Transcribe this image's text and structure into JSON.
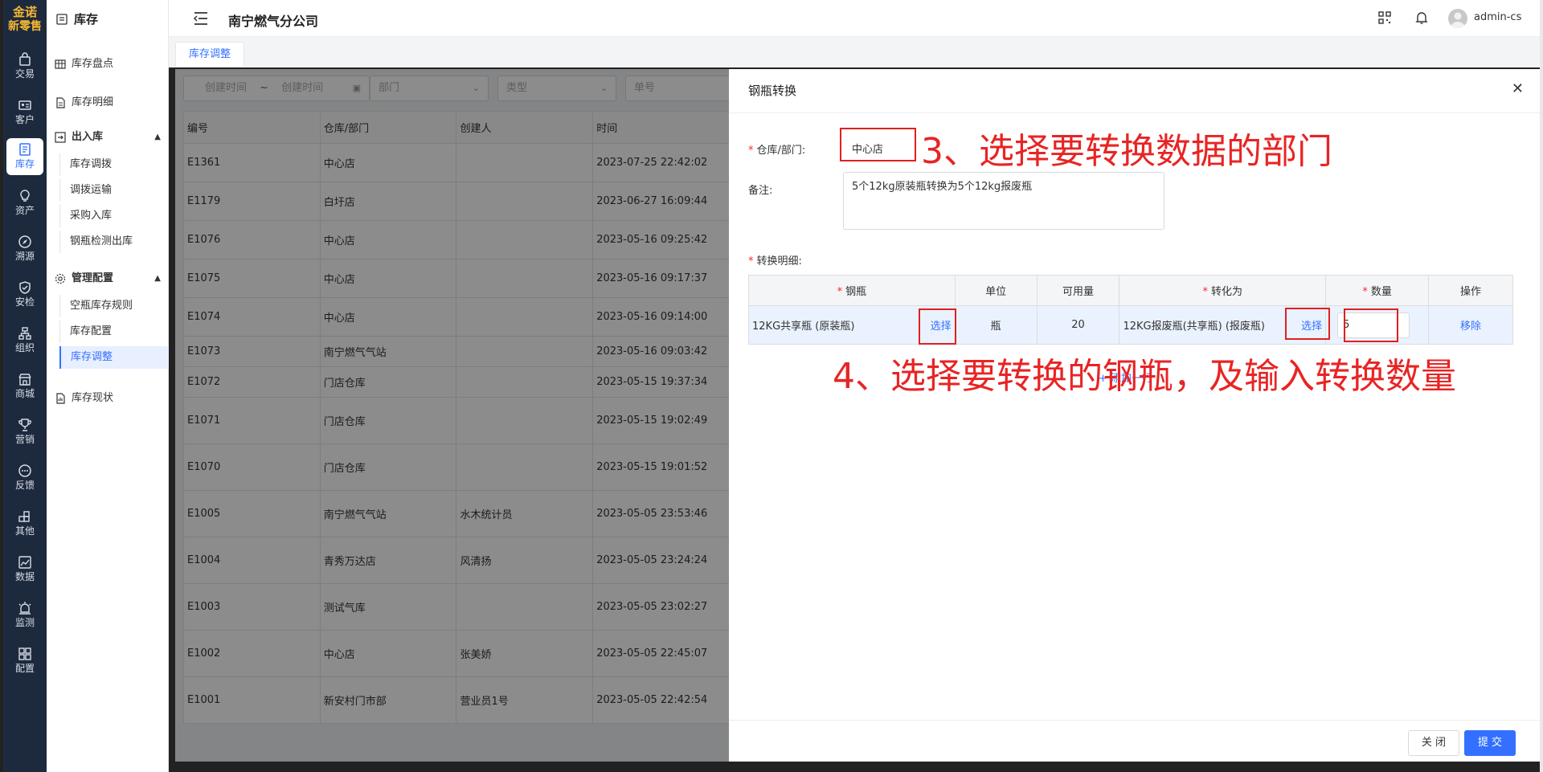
{
  "brand": {
    "line1": "金诺",
    "line2": "新零售",
    "color": "#f5b731"
  },
  "rail": [
    {
      "key": "trade",
      "label": "交易",
      "icon": "bag-icon"
    },
    {
      "key": "customer",
      "label": "客户",
      "icon": "id-card-icon"
    },
    {
      "key": "stock",
      "label": "库存",
      "icon": "list-icon",
      "active": true
    },
    {
      "key": "asset",
      "label": "资产",
      "icon": "bulb-icon"
    },
    {
      "key": "trace",
      "label": "溯源",
      "icon": "compass-icon"
    },
    {
      "key": "safety",
      "label": "安检",
      "icon": "shield-icon"
    },
    {
      "key": "org",
      "label": "组织",
      "icon": "org-icon"
    },
    {
      "key": "mall",
      "label": "商城",
      "icon": "store-icon"
    },
    {
      "key": "marketing",
      "label": "营销",
      "icon": "trophy-icon"
    },
    {
      "key": "feedback",
      "label": "反馈",
      "icon": "chat-icon"
    },
    {
      "key": "other",
      "label": "其他",
      "icon": "blocks-icon"
    },
    {
      "key": "data",
      "label": "数据",
      "icon": "chart-icon"
    },
    {
      "key": "monitor",
      "label": "监测",
      "icon": "alarm-icon"
    },
    {
      "key": "config",
      "label": "配置",
      "icon": "grid-icon"
    }
  ],
  "subnav": {
    "title": "库存",
    "items": [
      {
        "label": "库存盘点"
      },
      {
        "label": "库存明细"
      }
    ],
    "group1": {
      "label": "出入库",
      "children": [
        "库存调拨",
        "调拨运输",
        "采购入库",
        "钢瓶检测出库"
      ]
    },
    "group2": {
      "label": "管理配置",
      "children": [
        "空瓶库存规则",
        "库存配置",
        "库存调整"
      ]
    },
    "last": "库存现状"
  },
  "header": {
    "company": "南宁燃气分公司",
    "user": "admin-cs"
  },
  "tabs": [
    {
      "label": "库存调整"
    }
  ],
  "filters": {
    "date_start": "创建时间",
    "date_sep": "~",
    "date_end": "创建时间",
    "dept": "部门",
    "type": "类型",
    "no": "单号"
  },
  "table": {
    "columns": [
      "编号",
      "仓库/部门",
      "创建人",
      "时间"
    ],
    "rows": [
      [
        "E1361",
        "中心店",
        "",
        "2023-07-25 22:42:02"
      ],
      [
        "E1179",
        "白圩店",
        "",
        "2023-06-27 16:09:44"
      ],
      [
        "E1076",
        "中心店",
        "",
        "2023-05-16 09:25:42"
      ],
      [
        "E1075",
        "中心店",
        "",
        "2023-05-16 09:17:37"
      ],
      [
        "E1074",
        "中心店",
        "",
        "2023-05-16 09:14:00"
      ],
      [
        "E1073",
        "南宁燃气气站",
        "",
        "2023-05-16 09:03:42"
      ],
      [
        "E1072",
        "门店仓库",
        "",
        "2023-05-15 19:37:34"
      ],
      [
        "E1071",
        "门店仓库",
        "",
        "2023-05-15 19:02:49"
      ],
      [
        "E1070",
        "门店仓库",
        "",
        "2023-05-15 19:01:52"
      ],
      [
        "E1005",
        "南宁燃气气站",
        "水木统计员",
        "2023-05-05 23:53:46"
      ],
      [
        "E1004",
        "青秀万达店",
        "风清扬",
        "2023-05-05 23:24:24"
      ],
      [
        "E1003",
        "测试气库",
        "",
        "2023-05-05 23:02:27"
      ],
      [
        "E1002",
        "中心店",
        "张美娇",
        "2023-05-05 22:45:07"
      ],
      [
        "E1001",
        "新安村门市部",
        "营业员1号",
        "2023-05-05 22:42:54"
      ]
    ]
  },
  "drawer": {
    "title": "钢瓶转换",
    "warehouse_label": "仓库/部门:",
    "warehouse_value": "中心店",
    "note_label": "备注:",
    "note_value": "5个12kg原装瓶转换为5个12kg报废瓶",
    "detail_label": "转换明细:",
    "detail_columns": {
      "bottle": "钢瓶",
      "unit": "单位",
      "available": "可用量",
      "convert_to": "转化为",
      "qty": "数量",
      "op": "操作"
    },
    "row": {
      "bottle": "12KG共享瓶 (原装瓶)",
      "select1": "选择",
      "unit": "瓶",
      "available": "20",
      "convert_to": "12KG报废瓶(共享瓶)   (报废瓶)",
      "select2": "选择",
      "qty": "5",
      "remove": "移除"
    },
    "add_row": "+ 添加一行",
    "btn_close": "关 闭",
    "btn_submit": "提 交"
  },
  "annotations": {
    "step3": "3、选择要转换数据的部门",
    "step4": "4、选择要转换的钢瓶，及输入转换数量",
    "color": "#e82424"
  }
}
